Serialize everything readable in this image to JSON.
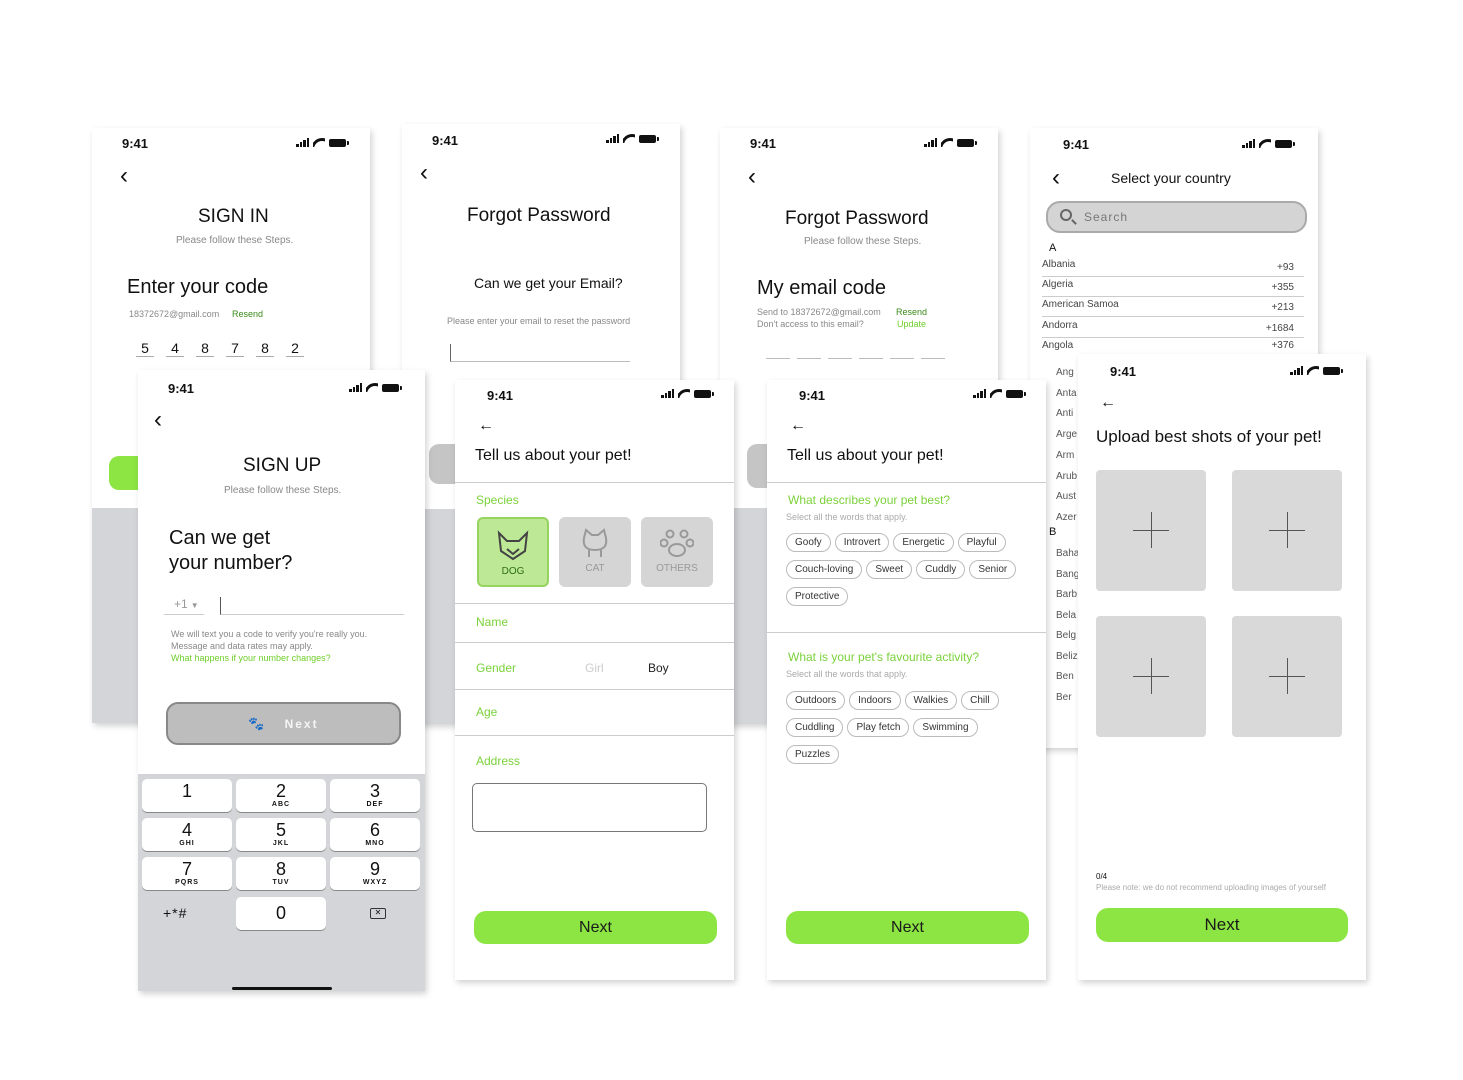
{
  "status": {
    "time": "9:41"
  },
  "signin": {
    "title": "SIGN IN",
    "subtitle": "Please follow these Steps.",
    "heading": "Enter your code",
    "email": "18372672@gmail.com",
    "resend": "Resend",
    "code": [
      "5",
      "4",
      "8",
      "7",
      "8",
      "2"
    ]
  },
  "forgot1": {
    "title": "Forgot Password",
    "question": "Can we get your Email?",
    "hint": "Please enter your email to reset the password"
  },
  "forgot2": {
    "title": "Forgot Password",
    "subtitle": "Please follow these Steps.",
    "heading": "My email code",
    "sent_to": "Send to 18372672@gmail.com",
    "resend": "Resend",
    "no_access": "Don't access to this email?",
    "update": "Update"
  },
  "country": {
    "title": "Select your country",
    "search_placeholder": "Search",
    "section_a": "A",
    "section_b": "B",
    "items": [
      {
        "name": "Albania",
        "code": "+93"
      },
      {
        "name": "Algeria",
        "code": "+355"
      },
      {
        "name": "American Samoa",
        "code": "+213"
      },
      {
        "name": "Andorra",
        "code": "+1684"
      },
      {
        "name": "Angola",
        "code": "+376"
      }
    ],
    "partial_a": [
      "Ang",
      "Anta",
      "Anti",
      "Arge",
      "Arm",
      "Arub",
      "Aust",
      "Azer"
    ],
    "partial_b": [
      "Baha",
      "Bang",
      "Barb",
      "Bela",
      "Belg",
      "Beliz",
      "Ben",
      "Ber"
    ]
  },
  "signup": {
    "title": "SIGN UP",
    "subtitle": "Please follow these Steps.",
    "heading_line1": "Can we get",
    "heading_line2": "your number?",
    "country_code": "+1",
    "note1": "We will text you a code to verify you're really you.",
    "note2": "Message and data rates may apply.",
    "note_link": "What happens if your number changes?",
    "next": "Next",
    "keys": [
      {
        "n": "1",
        "l": ""
      },
      {
        "n": "2",
        "l": "ABC"
      },
      {
        "n": "3",
        "l": "DEF"
      },
      {
        "n": "4",
        "l": "GHI"
      },
      {
        "n": "5",
        "l": "JKL"
      },
      {
        "n": "6",
        "l": "MNO"
      },
      {
        "n": "7",
        "l": "PQRS"
      },
      {
        "n": "8",
        "l": "TUV"
      },
      {
        "n": "9",
        "l": "WXYZ"
      }
    ],
    "key_special": "+*#",
    "key_zero": "0"
  },
  "pet1": {
    "title": "Tell us about your pet!",
    "species_label": "Species",
    "species": [
      "DOG",
      "CAT",
      "OTHERS"
    ],
    "name_label": "Name",
    "gender_label": "Gender",
    "gender_girl": "Girl",
    "gender_boy": "Boy",
    "age_label": "Age",
    "address_label": "Address",
    "next": "Next"
  },
  "pet2": {
    "title": "Tell us about your pet!",
    "q1": "What describes your pet best?",
    "q1_hint": "Select all the words that apply.",
    "traits": [
      "Goofy",
      "Introvert",
      "Energetic",
      "Playful",
      "Couch-loving",
      "Sweet",
      "Cuddly",
      "Senior",
      "Protective"
    ],
    "q2": "What is your pet's favourite activity?",
    "q2_hint": "Select all the words that apply.",
    "activities": [
      "Outdoors",
      "Indoors",
      "Walkies",
      "Chill",
      "Cuddling",
      "Play fetch",
      "Swimming",
      "Puzzles"
    ],
    "next": "Next"
  },
  "upload": {
    "title": "Upload best shots of your pet!",
    "count": "0/4",
    "note": "Please note: we do not recommend uploading images of yourself",
    "next": "Next"
  },
  "colors": {
    "accent": "#8ce543",
    "accent_text": "#6fcf2a"
  }
}
